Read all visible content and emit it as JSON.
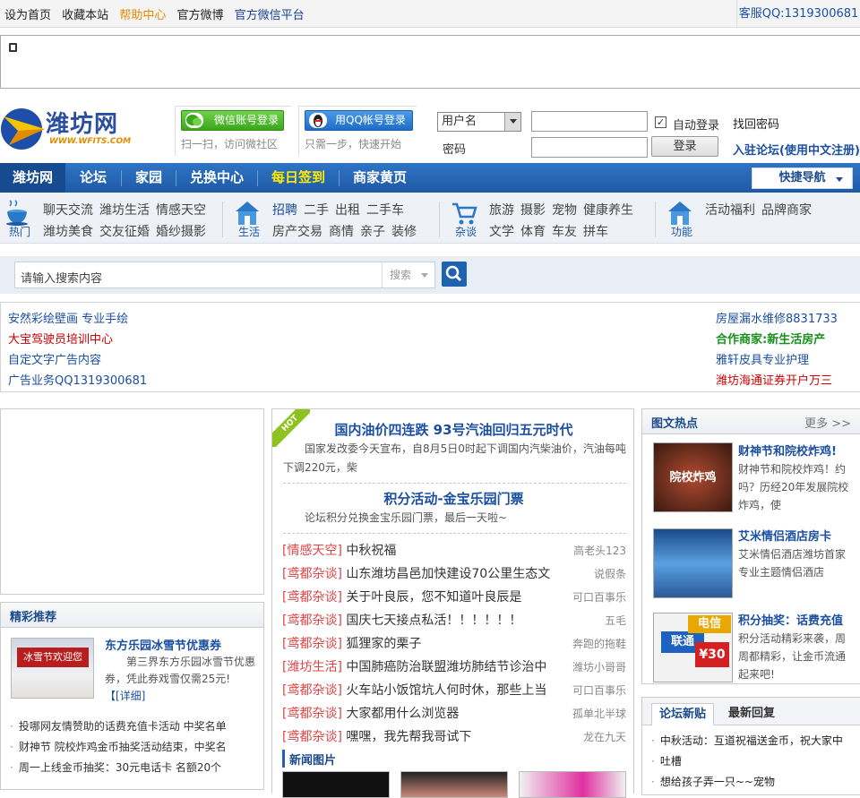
{
  "topbar": {
    "links": [
      "设为首页",
      "收藏本站",
      "帮助中心",
      "官方微博",
      "官方微信平台"
    ],
    "service_qq": "客服QQ:1319300681"
  },
  "logo": {
    "name": "潍坊网",
    "domain": "WWW.WFITS.COM"
  },
  "login": {
    "wechat_button": "微信账号登录",
    "wechat_tip": "扫一扫，访问微社区",
    "qq_button": "用QQ帐号登录",
    "qq_tip": "只需一步，快速开始",
    "username_select": "用户名",
    "password_label": "密码",
    "auto_login": "自动登录",
    "find_password": "找回密码",
    "login_button": "登录",
    "register": "入驻论坛(使用中文注册)"
  },
  "nav": {
    "items": [
      "潍坊网",
      "论坛",
      "家园",
      "兑换中心",
      "每日签到",
      "商家黄页"
    ],
    "quick_nav": "快捷导航"
  },
  "categories": [
    {
      "label": "热门",
      "row1": [
        "聊天交流",
        "潍坊生活",
        "情感天空"
      ],
      "row2": [
        "潍坊美食",
        "交友征婚",
        "婚纱摄影"
      ]
    },
    {
      "label": "生活",
      "row1": [
        "招聘",
        "二手",
        "出租",
        "二手车"
      ],
      "row2": [
        "房产交易",
        "商情",
        "亲子",
        "装修"
      ]
    },
    {
      "label": "杂谈",
      "row1": [
        "旅游",
        "摄影",
        "宠物",
        "健康养生"
      ],
      "row2": [
        "文学",
        "体育",
        "车友",
        "拼车"
      ]
    },
    {
      "label": "功能",
      "row1": [
        "活动福利",
        "品牌商家"
      ],
      "row2": []
    }
  ],
  "search": {
    "placeholder": "请输入搜索内容",
    "scope": "搜索"
  },
  "ads": {
    "left": [
      "安然彩绘壁画  专业手绘",
      "大宝驾驶员培训中心",
      "自定文字广告内容",
      "广告业务QQ1319300681"
    ],
    "right": [
      "房屋漏水维修8831733",
      "合作商家:新生活房产",
      "雅轩皮具专业护理",
      "潍坊海通证券开户万三"
    ]
  },
  "featured": {
    "title": "精彩推荐",
    "pic_sign": "冰雪节欢迎您",
    "headline": "东方乐园冰雪节优惠券",
    "desc": "第三界东方乐园冰雪节优惠券，凭此券戏雪仅需25元!",
    "detail": "【[详细]",
    "list": [
      "投哪网友情赞助的话费充值卡活动  中奖名单",
      "财神节  院校炸鸡金币抽奖活动结束，中奖名",
      "周一上线金币抽奖：30元电话卡  名额20个"
    ]
  },
  "middle": {
    "hot_badge": "HOT",
    "headline1": "国内油价四连跌  93号汽油回归五元时代",
    "desc1": "国家发改委今天宣布，自8月5日0时起下调国内汽柴油价，汽油每吨下调220元，柴",
    "headline2": "积分活动-金宝乐园门票",
    "desc2": "论坛积分兑换金宝乐园门票，最后一天啦~",
    "threads": [
      {
        "cat": "[情感天空]",
        "title": "中秋祝福",
        "author": "高老头123"
      },
      {
        "cat": "[鸢都杂谈]",
        "title": "山东潍坊昌邑加快建设70公里生态文",
        "author": "说假条"
      },
      {
        "cat": "[鸢都杂谈]",
        "title": "关于叶良辰，您不知道叶良辰是",
        "author": "可口百事乐"
      },
      {
        "cat": "[鸢都杂谈]",
        "title": "国庆七天接点私活！！！！！！",
        "author": "五毛"
      },
      {
        "cat": "[鸢都杂谈]",
        "title": "狐狸家的栗子",
        "author": "奔跑的拖鞋"
      },
      {
        "cat": "[潍坊生活]",
        "title": "中国肺癌防治联盟潍坊肺结节诊治中",
        "author": "潍坊小哥哥"
      },
      {
        "cat": "[鸢都杂谈]",
        "title": "火车站小饭馆坑人何时休，那些上当",
        "author": "可口百事乐"
      },
      {
        "cat": "[鸢都杂谈]",
        "title": "大家都用什么浏览器",
        "author": "孤单北半球"
      },
      {
        "cat": "[鸢都杂谈]",
        "title": "嘿嘿，我先帮我哥试下",
        "author": "龙在九天"
      }
    ],
    "news_pics": "新闻图片"
  },
  "picnews": {
    "title": "图文热点",
    "more": "更多 >>",
    "items": [
      {
        "title": "财神节和院校炸鸡!",
        "desc": "财神节和院校炸鸡！约吗？历经20年发展院校炸鸡，使",
        "pic_text": "院校炸鸡"
      },
      {
        "title": "艾米情侣酒店房卡",
        "desc": "艾米情侣酒店潍坊首家专业主题情侣酒店",
        "pic_text": ""
      },
      {
        "title": "积分抽奖：话费充值",
        "desc": "积分活动精彩来袭，周周都精彩，让金币流通起来吧!",
        "pic_text1": "联通",
        "pic_text2": "电信",
        "pic_text3": "¥30"
      }
    ]
  },
  "forum": {
    "tabs": [
      "论坛新贴",
      "最新回复"
    ],
    "posts": [
      "中秋活动：互道祝福送金币，祝大家中",
      "吐槽",
      "想给孩子弄一只~~宠物"
    ]
  },
  "colors": {
    "nav_blue": "#1e5aa6",
    "link_blue": "#1b4fa0",
    "orange": "#e28a00",
    "red": "#cc0000",
    "green": "#18901e"
  }
}
